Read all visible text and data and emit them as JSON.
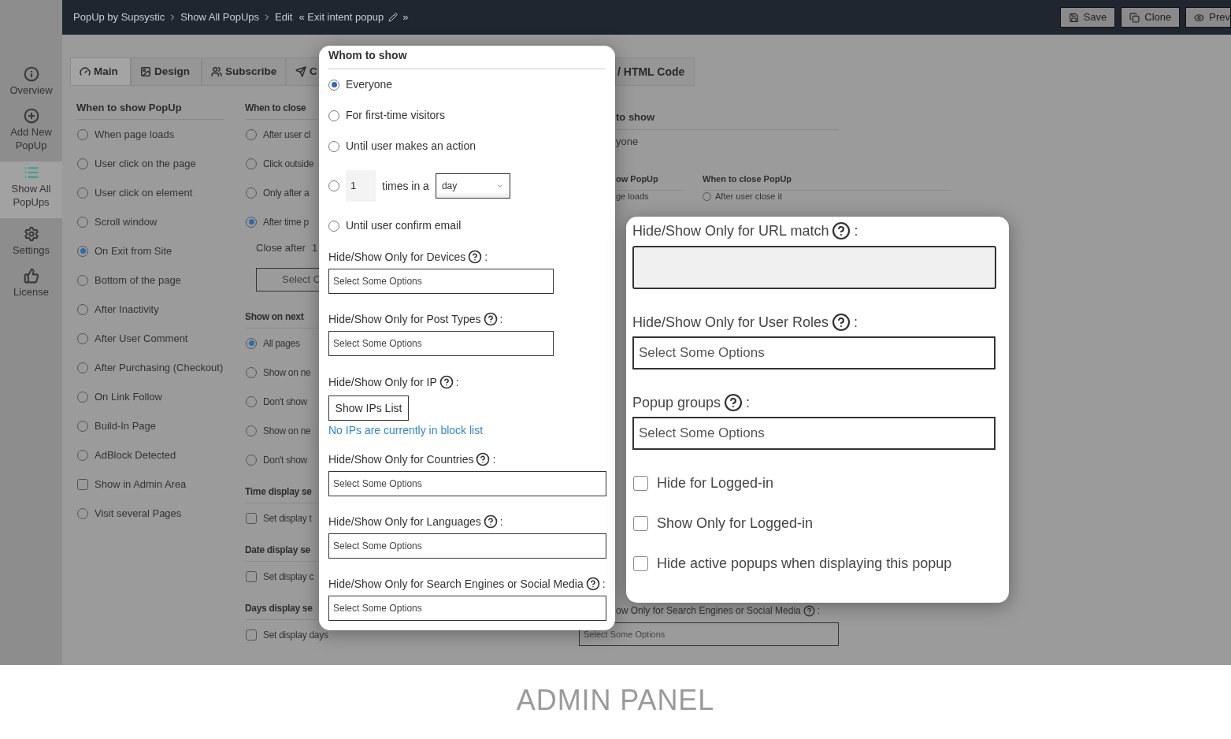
{
  "breadcrumb": {
    "items": [
      "PopUp by Supsystic",
      "Show All PopUps",
      "Edit"
    ],
    "title": "« Exit intent popup",
    "tail": "»"
  },
  "toolbar": [
    {
      "label": "Save"
    },
    {
      "label": "Clone"
    },
    {
      "label": "Prev"
    }
  ],
  "sidebar": [
    {
      "label": "Overview",
      "selected": false
    },
    {
      "label": "Add New PopUp",
      "selected": false
    },
    {
      "label": "Show All PopUps",
      "selected": true
    },
    {
      "label": "Settings",
      "selected": false
    },
    {
      "label": "License",
      "selected": false
    }
  ],
  "tabs": [
    {
      "label": "Main",
      "selected": true
    },
    {
      "label": "Design",
      "selected": false
    },
    {
      "label": "Subscribe",
      "selected": false
    },
    {
      "label": "C",
      "selected": false
    }
  ],
  "tab_right": {
    "label": "/ HTML Code",
    "selected": false
  },
  "show_column": [
    {
      "kind": "heading",
      "label": "When to show PopUp"
    },
    {
      "kind": "radio",
      "label": "When page loads",
      "checked": false
    },
    {
      "kind": "radio",
      "label": "User click on the page",
      "checked": false
    },
    {
      "kind": "radio",
      "label": "User click on element",
      "checked": false
    },
    {
      "kind": "radio",
      "label": "Scroll window",
      "checked": false
    },
    {
      "kind": "radio",
      "label": "On Exit from Site",
      "checked": true
    },
    {
      "kind": "radio",
      "label": "Bottom of the page",
      "checked": false
    },
    {
      "kind": "radio",
      "label": "After Inactivity",
      "checked": false
    },
    {
      "kind": "radio",
      "label": "After User Comment",
      "checked": false
    },
    {
      "kind": "radio",
      "label": "After Purchasing (Checkout)",
      "checked": false
    },
    {
      "kind": "radio",
      "label": "On Link Follow",
      "checked": false
    },
    {
      "kind": "radio",
      "label": "Build-In Page",
      "checked": false
    },
    {
      "kind": "radio",
      "label": "AdBlock Detected",
      "checked": false
    },
    {
      "kind": "checkbox",
      "label": "Show in Admin Area",
      "checked": false
    },
    {
      "kind": "radio",
      "label": "Visit several Pages",
      "checked": false
    }
  ],
  "close_column": [
    {
      "kind": "heading",
      "label": "When to close"
    },
    {
      "kind": "radio",
      "label": "After user cl",
      "checked": false
    },
    {
      "kind": "radio",
      "label": "Click outside",
      "checked": false
    },
    {
      "kind": "radio",
      "label": "Only after a",
      "checked": false
    },
    {
      "kind": "radio",
      "label": "After time p",
      "checked": true
    },
    {
      "kind": "text",
      "label": "Close after",
      "value": "1"
    },
    {
      "kind": "select",
      "label": "Select C"
    },
    {
      "kind": "heading",
      "label": "Show on next"
    },
    {
      "kind": "radio",
      "label": "All pages",
      "checked": true
    },
    {
      "kind": "radio",
      "label": "Show on ne",
      "checked": false
    },
    {
      "kind": "radio",
      "label": "Don't show",
      "checked": false
    },
    {
      "kind": "radio",
      "label": "Show on ne",
      "checked": false
    },
    {
      "kind": "radio",
      "label": "Don't show",
      "checked": false
    },
    {
      "kind": "heading",
      "label": "Time display se"
    },
    {
      "kind": "checkbox",
      "label": "Set display t",
      "checked": false
    },
    {
      "kind": "heading",
      "label": "Date display se"
    },
    {
      "kind": "checkbox",
      "label": "Set display c",
      "checked": false
    },
    {
      "kind": "heading",
      "label": "Days display se"
    },
    {
      "kind": "checkbox",
      "label": "Set display days",
      "checked": false
    }
  ],
  "background_panel": {
    "whom_heading": "to show",
    "whom_option": "yone",
    "show_heading": "ow PopUp",
    "close_heading": "When to close PopUp",
    "show_option": "ge loads",
    "close_option": {
      "label": "After user close it",
      "checked": false
    },
    "bottom_label": "ow Only for Search Engines or Social Media",
    "bottom_suffix": ":",
    "bottom_select": "Select Some Options"
  },
  "whom_card": {
    "title": "Whom to show",
    "options": [
      {
        "kind": "radio",
        "label": "Everyone",
        "selected": true
      },
      {
        "kind": "radio",
        "label": "For first-time visitors",
        "selected": false
      },
      {
        "kind": "radio",
        "label": "Until user makes an action",
        "selected": false
      },
      {
        "kind": "count",
        "value": "1",
        "label": "times in a",
        "period": "day",
        "selected": false
      },
      {
        "kind": "radio",
        "label": "Until user confirm email",
        "selected": false
      }
    ],
    "fields": [
      {
        "kind": "select",
        "label": "Hide/Show Only for Devices",
        "suffix": ":",
        "placeholder": "Select Some Options"
      },
      {
        "kind": "select",
        "label": "Hide/Show Only for Post Types",
        "suffix": ":",
        "placeholder": "Select Some Options"
      },
      {
        "kind": "ip",
        "label": "Hide/Show Only for IP",
        "suffix": ":",
        "button": "Show IPs List",
        "note": "No IPs are currently in block list"
      },
      {
        "kind": "select",
        "label": "Hide/Show Only for Countries",
        "suffix": ":",
        "placeholder": "Select Some Options"
      },
      {
        "kind": "select",
        "label": "Hide/Show Only for Languages",
        "suffix": ":",
        "placeholder": "Select Some Options"
      },
      {
        "kind": "select",
        "label": "Hide/Show Only for Search Engines or Social Media",
        "suffix": ":",
        "placeholder": "Select Some Options"
      }
    ]
  },
  "filters_card": {
    "fields": [
      {
        "kind": "textarea",
        "label": "Hide/Show Only for URL match",
        "suffix": ":"
      },
      {
        "kind": "select",
        "label": "Hide/Show Only for User Roles",
        "suffix": ":",
        "placeholder": "Select Some Options"
      },
      {
        "kind": "select",
        "label": "Popup groups",
        "suffix": ":",
        "placeholder": "Select Some Options"
      }
    ],
    "checks": [
      {
        "label": "Hide for Logged-in",
        "checked": false
      },
      {
        "label": "Show Only for Logged-in",
        "checked": false
      },
      {
        "label": "Hide active popups when displaying this popup",
        "checked": false
      }
    ]
  },
  "caption": "ADMIN PANEL"
}
